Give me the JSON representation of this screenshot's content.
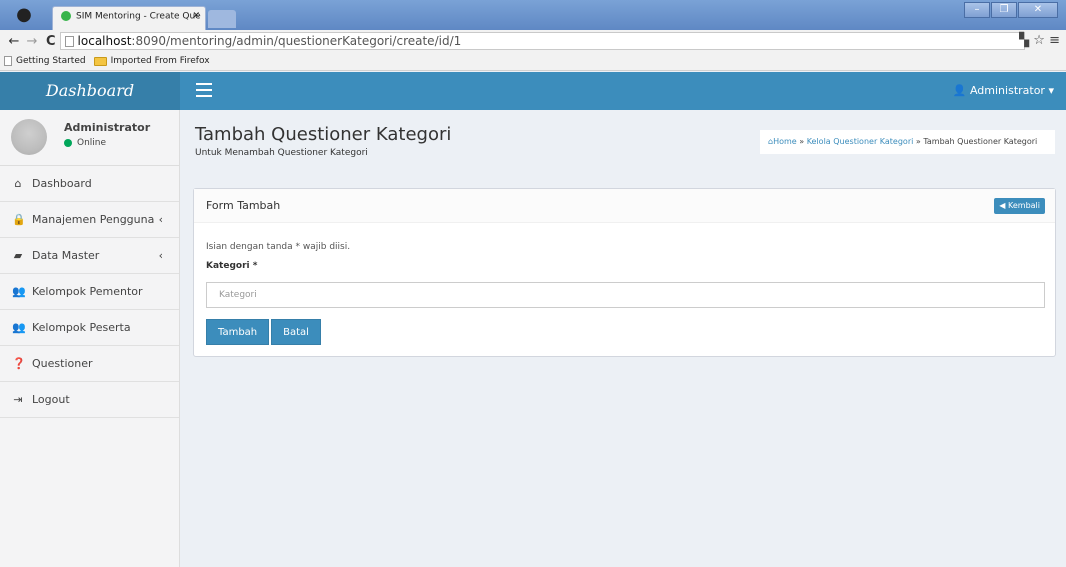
{
  "browser": {
    "tab_title": "SIM Mentoring - Create Que",
    "url_host": "localhost",
    "url_path": ":8090/mentoring/admin/questionerKategori/create/id/1",
    "bookmarks": [
      "Getting Started",
      "Imported From Firefox"
    ]
  },
  "header": {
    "brand": "Dashboard",
    "user_menu": "Administrator"
  },
  "sidebar": {
    "user_name": "Administrator",
    "user_status": "Online",
    "items": [
      {
        "label": "Dashboard",
        "icon": "home-icon"
      },
      {
        "label": "Manajemen Pengguna",
        "icon": "lock-icon"
      },
      {
        "label": "Data Master",
        "icon": "book-icon"
      },
      {
        "label": "Kelompok Pementor",
        "icon": "users-icon"
      },
      {
        "label": "Kelompok Peserta",
        "icon": "users-icon"
      },
      {
        "label": "Questioner",
        "icon": "question-icon"
      },
      {
        "label": "Logout",
        "icon": "sign-out-icon"
      }
    ]
  },
  "page": {
    "title": "Tambah Questioner Kategori",
    "subtitle": "Untuk Menambah Questioner Kategori",
    "breadcrumb_home": "Home",
    "breadcrumb_parent": "Kelola Questioner Kategori",
    "breadcrumb_current": "Tambah Questioner Kategori"
  },
  "form": {
    "box_title": "Form Tambah",
    "back_label": "Kembali",
    "hint": "Isian dengan tanda * wajib diisi.",
    "field_label": "Kategori *",
    "field_placeholder": "Kategori",
    "submit_label": "Tambah",
    "cancel_label": "Batal"
  },
  "colors": {
    "primary": "#3c8dbc",
    "brand_bg": "#367fa9",
    "online": "#00a65a"
  }
}
